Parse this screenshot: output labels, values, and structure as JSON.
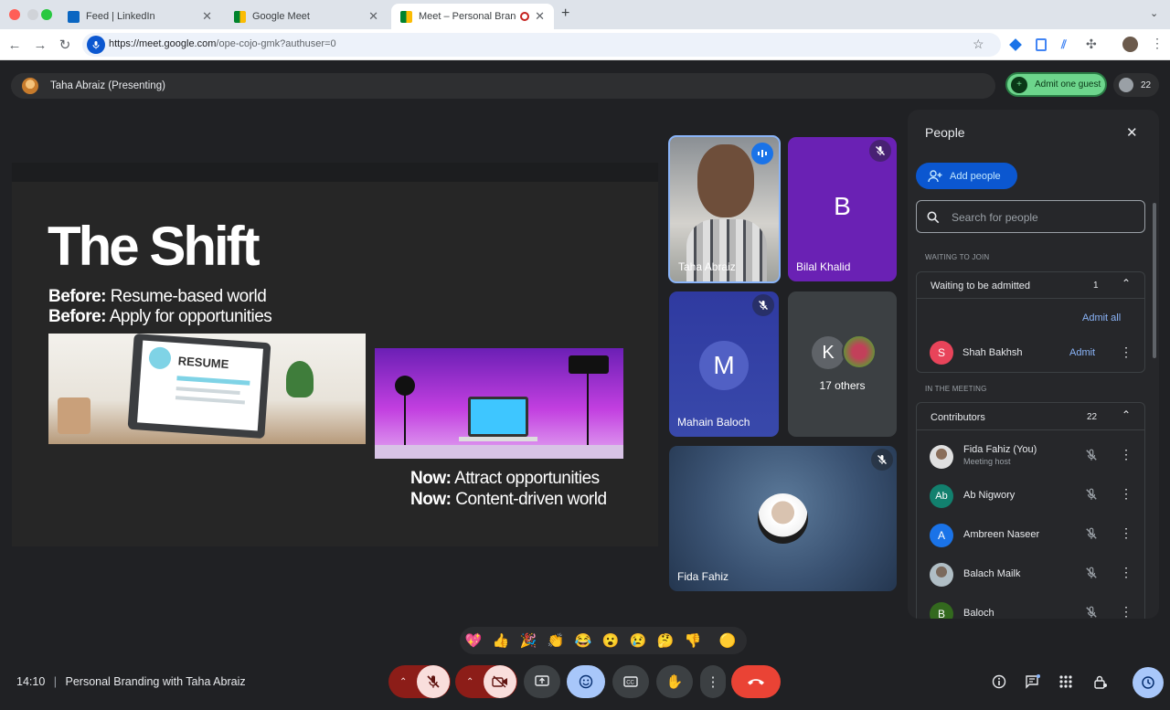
{
  "browser": {
    "tabs": [
      {
        "title": "Feed | LinkedIn",
        "icon": "linkedin-icon"
      },
      {
        "title": "Google Meet",
        "icon": "meet-icon"
      },
      {
        "title": "Meet – Personal Branding",
        "icon": "meet-icon",
        "active": true
      }
    ],
    "url_host": "https://meet.google.com",
    "url_path": "/ope-cojo-gmk?authuser=0"
  },
  "meeting": {
    "presenter_label": "Taha Abraiz (Presenting)",
    "admit_button": "Admit one guest",
    "participant_count": "22",
    "time": "14:10",
    "separator": "|",
    "title": "Personal Branding with Taha Abraiz"
  },
  "slide": {
    "heading": "The Shift",
    "before_label": "Before:",
    "before_line1": "Resume-based world",
    "before_line2": "Apply for opportunities",
    "resume_word": "RESUME",
    "now_label": "Now:",
    "now_line1": "Attract opportunities",
    "now_line2": "Content-driven world"
  },
  "tiles": [
    {
      "name": "Taha Abraiz",
      "speaking": true
    },
    {
      "name": "Bilal Khalid",
      "initial": "B",
      "color": "#6a21b4"
    },
    {
      "name": "Mahain Baloch",
      "initial": "M",
      "color": "#3949ab"
    },
    {
      "name": "17 others",
      "initial": "K"
    },
    {
      "name": "Fida Fahiz"
    }
  ],
  "people_panel": {
    "title": "People",
    "add_people": "Add people",
    "search_placeholder": "Search for people",
    "waiting_section": "WAITING TO JOIN",
    "waiting_group": "Waiting to be admitted",
    "waiting_count": "1",
    "admit_all": "Admit all",
    "waiting_person": {
      "name": "Shah Bakhsh",
      "initial": "S",
      "color": "#e8445a",
      "action": "Admit"
    },
    "meeting_section": "IN THE MEETING",
    "contributors_label": "Contributors",
    "contributors_count": "22",
    "contributors": [
      {
        "name": "Fida Fahiz (You)",
        "sub": "Meeting host",
        "initial": "",
        "color": "#cfd8dc",
        "photo": true
      },
      {
        "name": "Ab Nigwory",
        "initial": "Ab",
        "color": "#12806e"
      },
      {
        "name": "Ambreen Naseer",
        "initial": "A",
        "color": "#1a73e8"
      },
      {
        "name": "Balach Mailk",
        "initial": "",
        "color": "#b0bec5",
        "photo": true
      },
      {
        "name": "Baloch",
        "initial": "B",
        "color": "#33691e"
      }
    ]
  },
  "reactions": [
    "💖",
    "👍",
    "🎉",
    "👏",
    "😂",
    "😮",
    "😢",
    "🤔",
    "👎",
    "🟡"
  ],
  "colors": {
    "accent": "#8ab4f8",
    "admit_green": "#6dd58c",
    "end_call": "#ea4335",
    "mic_off_bg": "#f9dedc"
  }
}
